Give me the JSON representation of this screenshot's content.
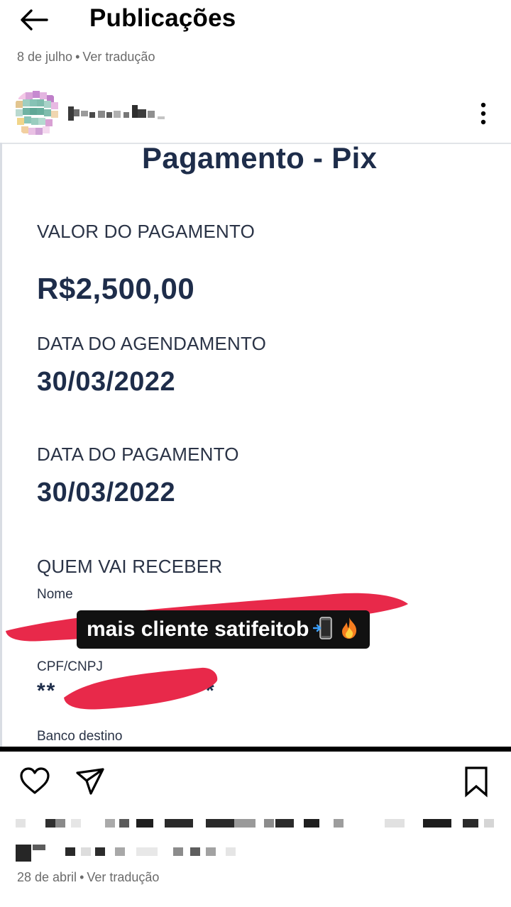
{
  "header": {
    "back_icon": "arrow-left-icon",
    "title": "Publicações"
  },
  "previous_post": {
    "date": "8 de julho",
    "separator": "•",
    "translate_label": "Ver tradução"
  },
  "post": {
    "more_icon": "more-vertical-icon",
    "image": {
      "title": "Pagamento - Pix",
      "amount_label": "VALOR DO PAGAMENTO",
      "amount_value": "R$2,500,00",
      "scheduled_label": "DATA DO AGENDAMENTO",
      "scheduled_value": "30/03/2022",
      "payment_label": "DATA DO PAGAMENTO",
      "payment_value": "30/03/2022",
      "receiver_label": "QUEM VAI RECEBER",
      "name_label": "Nome",
      "document_label": "CPF/CNPJ",
      "document_prefix": "**",
      "document_suffix": "*",
      "bank_label": "Banco destino",
      "sticker_text": "mais cliente satifeitob",
      "sticker_icons": [
        "mobile-arrow-icon",
        "fire-icon"
      ]
    },
    "actions": {
      "like_icon": "heart-icon",
      "share_icon": "send-icon",
      "save_icon": "bookmark-icon"
    },
    "date": "28 de abril",
    "separator": "•",
    "translate_label": "Ver tradução"
  },
  "colors": {
    "receipt_text": "#1e2d4a",
    "redaction": "#e8294a",
    "sticker_bg": "#111111",
    "meta_text": "#6b6b6b"
  }
}
